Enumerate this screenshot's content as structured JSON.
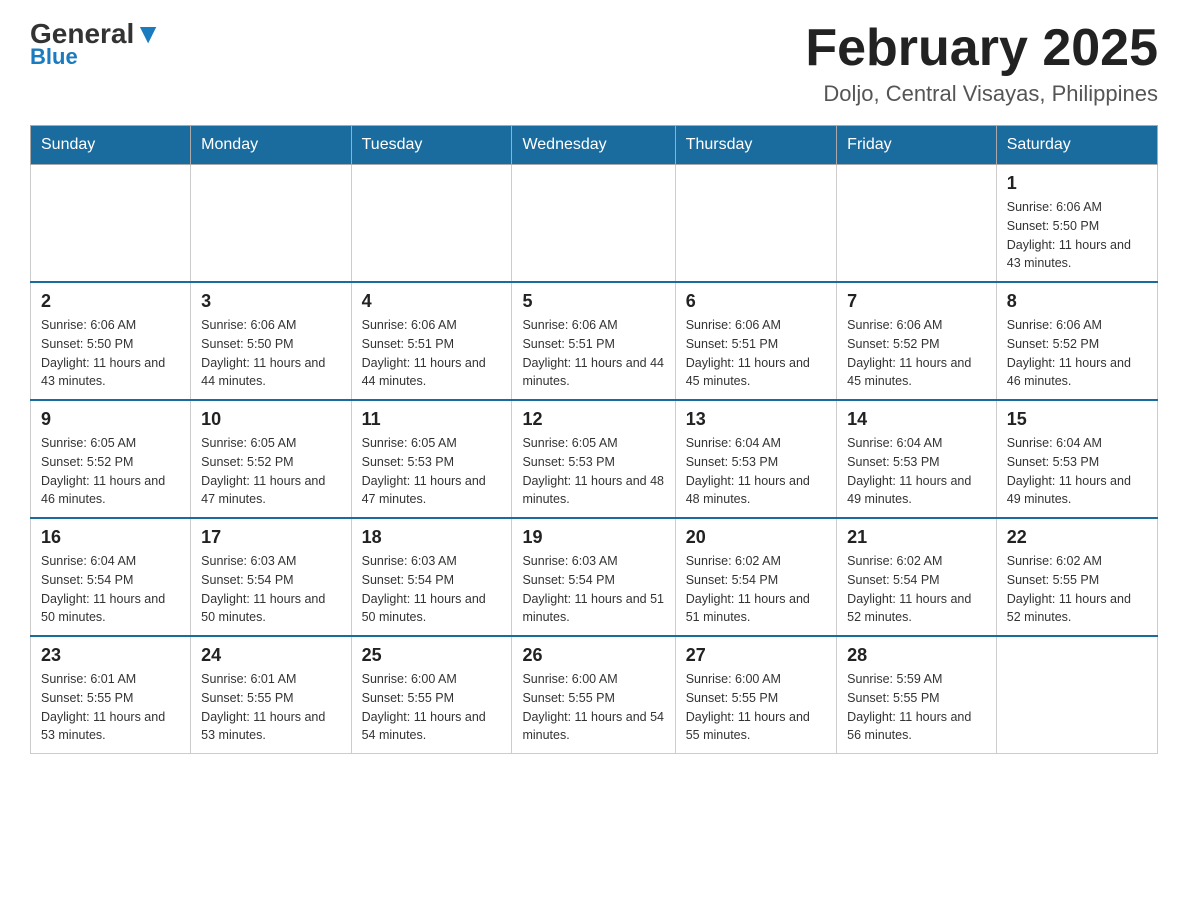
{
  "logo": {
    "general": "General",
    "blue": "Blue"
  },
  "title": "February 2025",
  "location": "Doljo, Central Visayas, Philippines",
  "days_of_week": [
    "Sunday",
    "Monday",
    "Tuesday",
    "Wednesday",
    "Thursday",
    "Friday",
    "Saturday"
  ],
  "weeks": [
    [
      {
        "day": "",
        "sunrise": "",
        "sunset": "",
        "daylight": ""
      },
      {
        "day": "",
        "sunrise": "",
        "sunset": "",
        "daylight": ""
      },
      {
        "day": "",
        "sunrise": "",
        "sunset": "",
        "daylight": ""
      },
      {
        "day": "",
        "sunrise": "",
        "sunset": "",
        "daylight": ""
      },
      {
        "day": "",
        "sunrise": "",
        "sunset": "",
        "daylight": ""
      },
      {
        "day": "",
        "sunrise": "",
        "sunset": "",
        "daylight": ""
      },
      {
        "day": "1",
        "sunrise": "Sunrise: 6:06 AM",
        "sunset": "Sunset: 5:50 PM",
        "daylight": "Daylight: 11 hours and 43 minutes."
      }
    ],
    [
      {
        "day": "2",
        "sunrise": "Sunrise: 6:06 AM",
        "sunset": "Sunset: 5:50 PM",
        "daylight": "Daylight: 11 hours and 43 minutes."
      },
      {
        "day": "3",
        "sunrise": "Sunrise: 6:06 AM",
        "sunset": "Sunset: 5:50 PM",
        "daylight": "Daylight: 11 hours and 44 minutes."
      },
      {
        "day": "4",
        "sunrise": "Sunrise: 6:06 AM",
        "sunset": "Sunset: 5:51 PM",
        "daylight": "Daylight: 11 hours and 44 minutes."
      },
      {
        "day": "5",
        "sunrise": "Sunrise: 6:06 AM",
        "sunset": "Sunset: 5:51 PM",
        "daylight": "Daylight: 11 hours and 44 minutes."
      },
      {
        "day": "6",
        "sunrise": "Sunrise: 6:06 AM",
        "sunset": "Sunset: 5:51 PM",
        "daylight": "Daylight: 11 hours and 45 minutes."
      },
      {
        "day": "7",
        "sunrise": "Sunrise: 6:06 AM",
        "sunset": "Sunset: 5:52 PM",
        "daylight": "Daylight: 11 hours and 45 minutes."
      },
      {
        "day": "8",
        "sunrise": "Sunrise: 6:06 AM",
        "sunset": "Sunset: 5:52 PM",
        "daylight": "Daylight: 11 hours and 46 minutes."
      }
    ],
    [
      {
        "day": "9",
        "sunrise": "Sunrise: 6:05 AM",
        "sunset": "Sunset: 5:52 PM",
        "daylight": "Daylight: 11 hours and 46 minutes."
      },
      {
        "day": "10",
        "sunrise": "Sunrise: 6:05 AM",
        "sunset": "Sunset: 5:52 PM",
        "daylight": "Daylight: 11 hours and 47 minutes."
      },
      {
        "day": "11",
        "sunrise": "Sunrise: 6:05 AM",
        "sunset": "Sunset: 5:53 PM",
        "daylight": "Daylight: 11 hours and 47 minutes."
      },
      {
        "day": "12",
        "sunrise": "Sunrise: 6:05 AM",
        "sunset": "Sunset: 5:53 PM",
        "daylight": "Daylight: 11 hours and 48 minutes."
      },
      {
        "day": "13",
        "sunrise": "Sunrise: 6:04 AM",
        "sunset": "Sunset: 5:53 PM",
        "daylight": "Daylight: 11 hours and 48 minutes."
      },
      {
        "day": "14",
        "sunrise": "Sunrise: 6:04 AM",
        "sunset": "Sunset: 5:53 PM",
        "daylight": "Daylight: 11 hours and 49 minutes."
      },
      {
        "day": "15",
        "sunrise": "Sunrise: 6:04 AM",
        "sunset": "Sunset: 5:53 PM",
        "daylight": "Daylight: 11 hours and 49 minutes."
      }
    ],
    [
      {
        "day": "16",
        "sunrise": "Sunrise: 6:04 AM",
        "sunset": "Sunset: 5:54 PM",
        "daylight": "Daylight: 11 hours and 50 minutes."
      },
      {
        "day": "17",
        "sunrise": "Sunrise: 6:03 AM",
        "sunset": "Sunset: 5:54 PM",
        "daylight": "Daylight: 11 hours and 50 minutes."
      },
      {
        "day": "18",
        "sunrise": "Sunrise: 6:03 AM",
        "sunset": "Sunset: 5:54 PM",
        "daylight": "Daylight: 11 hours and 50 minutes."
      },
      {
        "day": "19",
        "sunrise": "Sunrise: 6:03 AM",
        "sunset": "Sunset: 5:54 PM",
        "daylight": "Daylight: 11 hours and 51 minutes."
      },
      {
        "day": "20",
        "sunrise": "Sunrise: 6:02 AM",
        "sunset": "Sunset: 5:54 PM",
        "daylight": "Daylight: 11 hours and 51 minutes."
      },
      {
        "day": "21",
        "sunrise": "Sunrise: 6:02 AM",
        "sunset": "Sunset: 5:54 PM",
        "daylight": "Daylight: 11 hours and 52 minutes."
      },
      {
        "day": "22",
        "sunrise": "Sunrise: 6:02 AM",
        "sunset": "Sunset: 5:55 PM",
        "daylight": "Daylight: 11 hours and 52 minutes."
      }
    ],
    [
      {
        "day": "23",
        "sunrise": "Sunrise: 6:01 AM",
        "sunset": "Sunset: 5:55 PM",
        "daylight": "Daylight: 11 hours and 53 minutes."
      },
      {
        "day": "24",
        "sunrise": "Sunrise: 6:01 AM",
        "sunset": "Sunset: 5:55 PM",
        "daylight": "Daylight: 11 hours and 53 minutes."
      },
      {
        "day": "25",
        "sunrise": "Sunrise: 6:00 AM",
        "sunset": "Sunset: 5:55 PM",
        "daylight": "Daylight: 11 hours and 54 minutes."
      },
      {
        "day": "26",
        "sunrise": "Sunrise: 6:00 AM",
        "sunset": "Sunset: 5:55 PM",
        "daylight": "Daylight: 11 hours and 54 minutes."
      },
      {
        "day": "27",
        "sunrise": "Sunrise: 6:00 AM",
        "sunset": "Sunset: 5:55 PM",
        "daylight": "Daylight: 11 hours and 55 minutes."
      },
      {
        "day": "28",
        "sunrise": "Sunrise: 5:59 AM",
        "sunset": "Sunset: 5:55 PM",
        "daylight": "Daylight: 11 hours and 56 minutes."
      },
      {
        "day": "",
        "sunrise": "",
        "sunset": "",
        "daylight": ""
      }
    ]
  ]
}
